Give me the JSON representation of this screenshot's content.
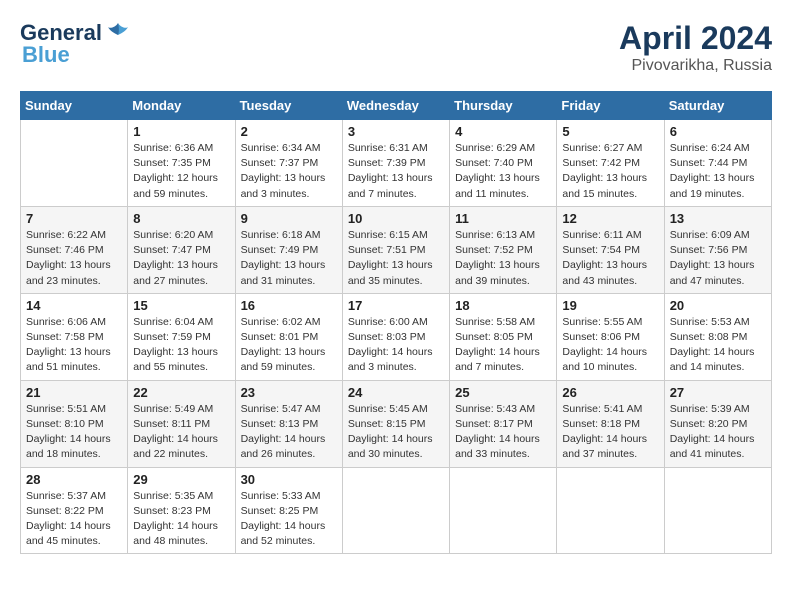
{
  "logo": {
    "line1": "General",
    "line2": "Blue",
    "bird": "▲"
  },
  "title": "April 2024",
  "subtitle": "Pivovarikha, Russia",
  "days_header": [
    "Sunday",
    "Monday",
    "Tuesday",
    "Wednesday",
    "Thursday",
    "Friday",
    "Saturday"
  ],
  "weeks": [
    [
      {
        "day": "",
        "info": ""
      },
      {
        "day": "1",
        "info": "Sunrise: 6:36 AM\nSunset: 7:35 PM\nDaylight: 12 hours\nand 59 minutes."
      },
      {
        "day": "2",
        "info": "Sunrise: 6:34 AM\nSunset: 7:37 PM\nDaylight: 13 hours\nand 3 minutes."
      },
      {
        "day": "3",
        "info": "Sunrise: 6:31 AM\nSunset: 7:39 PM\nDaylight: 13 hours\nand 7 minutes."
      },
      {
        "day": "4",
        "info": "Sunrise: 6:29 AM\nSunset: 7:40 PM\nDaylight: 13 hours\nand 11 minutes."
      },
      {
        "day": "5",
        "info": "Sunrise: 6:27 AM\nSunset: 7:42 PM\nDaylight: 13 hours\nand 15 minutes."
      },
      {
        "day": "6",
        "info": "Sunrise: 6:24 AM\nSunset: 7:44 PM\nDaylight: 13 hours\nand 19 minutes."
      }
    ],
    [
      {
        "day": "7",
        "info": "Sunrise: 6:22 AM\nSunset: 7:46 PM\nDaylight: 13 hours\nand 23 minutes."
      },
      {
        "day": "8",
        "info": "Sunrise: 6:20 AM\nSunset: 7:47 PM\nDaylight: 13 hours\nand 27 minutes."
      },
      {
        "day": "9",
        "info": "Sunrise: 6:18 AM\nSunset: 7:49 PM\nDaylight: 13 hours\nand 31 minutes."
      },
      {
        "day": "10",
        "info": "Sunrise: 6:15 AM\nSunset: 7:51 PM\nDaylight: 13 hours\nand 35 minutes."
      },
      {
        "day": "11",
        "info": "Sunrise: 6:13 AM\nSunset: 7:52 PM\nDaylight: 13 hours\nand 39 minutes."
      },
      {
        "day": "12",
        "info": "Sunrise: 6:11 AM\nSunset: 7:54 PM\nDaylight: 13 hours\nand 43 minutes."
      },
      {
        "day": "13",
        "info": "Sunrise: 6:09 AM\nSunset: 7:56 PM\nDaylight: 13 hours\nand 47 minutes."
      }
    ],
    [
      {
        "day": "14",
        "info": "Sunrise: 6:06 AM\nSunset: 7:58 PM\nDaylight: 13 hours\nand 51 minutes."
      },
      {
        "day": "15",
        "info": "Sunrise: 6:04 AM\nSunset: 7:59 PM\nDaylight: 13 hours\nand 55 minutes."
      },
      {
        "day": "16",
        "info": "Sunrise: 6:02 AM\nSunset: 8:01 PM\nDaylight: 13 hours\nand 59 minutes."
      },
      {
        "day": "17",
        "info": "Sunrise: 6:00 AM\nSunset: 8:03 PM\nDaylight: 14 hours\nand 3 minutes."
      },
      {
        "day": "18",
        "info": "Sunrise: 5:58 AM\nSunset: 8:05 PM\nDaylight: 14 hours\nand 7 minutes."
      },
      {
        "day": "19",
        "info": "Sunrise: 5:55 AM\nSunset: 8:06 PM\nDaylight: 14 hours\nand 10 minutes."
      },
      {
        "day": "20",
        "info": "Sunrise: 5:53 AM\nSunset: 8:08 PM\nDaylight: 14 hours\nand 14 minutes."
      }
    ],
    [
      {
        "day": "21",
        "info": "Sunrise: 5:51 AM\nSunset: 8:10 PM\nDaylight: 14 hours\nand 18 minutes."
      },
      {
        "day": "22",
        "info": "Sunrise: 5:49 AM\nSunset: 8:11 PM\nDaylight: 14 hours\nand 22 minutes."
      },
      {
        "day": "23",
        "info": "Sunrise: 5:47 AM\nSunset: 8:13 PM\nDaylight: 14 hours\nand 26 minutes."
      },
      {
        "day": "24",
        "info": "Sunrise: 5:45 AM\nSunset: 8:15 PM\nDaylight: 14 hours\nand 30 minutes."
      },
      {
        "day": "25",
        "info": "Sunrise: 5:43 AM\nSunset: 8:17 PM\nDaylight: 14 hours\nand 33 minutes."
      },
      {
        "day": "26",
        "info": "Sunrise: 5:41 AM\nSunset: 8:18 PM\nDaylight: 14 hours\nand 37 minutes."
      },
      {
        "day": "27",
        "info": "Sunrise: 5:39 AM\nSunset: 8:20 PM\nDaylight: 14 hours\nand 41 minutes."
      }
    ],
    [
      {
        "day": "28",
        "info": "Sunrise: 5:37 AM\nSunset: 8:22 PM\nDaylight: 14 hours\nand 45 minutes."
      },
      {
        "day": "29",
        "info": "Sunrise: 5:35 AM\nSunset: 8:23 PM\nDaylight: 14 hours\nand 48 minutes."
      },
      {
        "day": "30",
        "info": "Sunrise: 5:33 AM\nSunset: 8:25 PM\nDaylight: 14 hours\nand 52 minutes."
      },
      {
        "day": "",
        "info": ""
      },
      {
        "day": "",
        "info": ""
      },
      {
        "day": "",
        "info": ""
      },
      {
        "day": "",
        "info": ""
      }
    ]
  ]
}
